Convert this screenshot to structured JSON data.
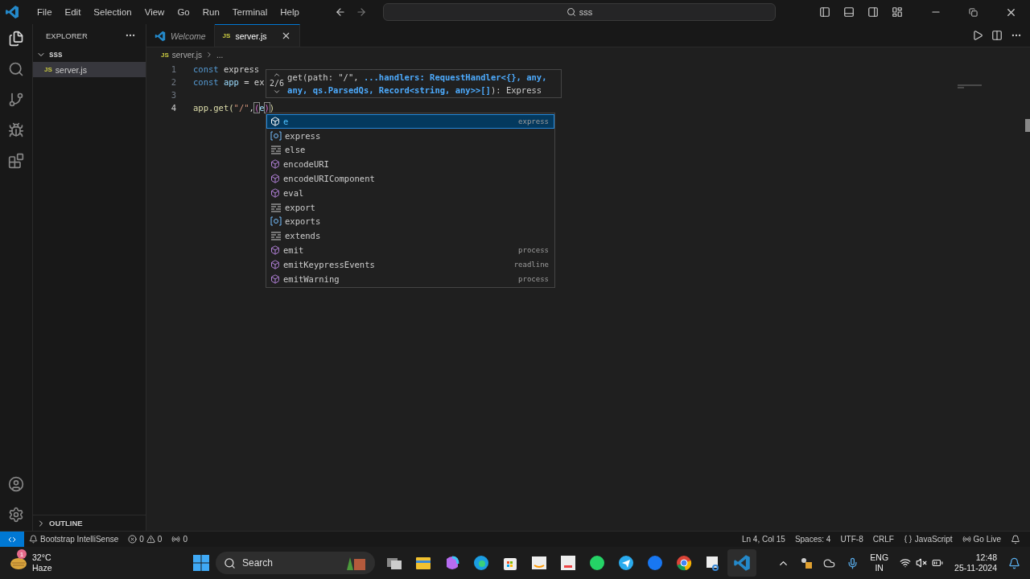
{
  "menu": [
    "File",
    "Edit",
    "Selection",
    "View",
    "Go",
    "Run",
    "Terminal",
    "Help"
  ],
  "command_center": {
    "value": "sss"
  },
  "sidebar": {
    "title": "EXPLORER",
    "folder": {
      "label": "sss",
      "expanded": true,
      "children": [
        {
          "label": "server.js",
          "badge": "JS",
          "selected": true
        }
      ]
    },
    "outline": {
      "label": "OUTLINE",
      "expanded": false
    }
  },
  "tabs": [
    {
      "label": "Welcome",
      "selected": false
    },
    {
      "label": "server.js",
      "badge": "JS",
      "selected": true
    }
  ],
  "breadcrumb": {
    "badge": "JS",
    "file": "server.js",
    "rest": "..."
  },
  "code_lines": [
    {
      "number": "1",
      "current": false,
      "tokens": [
        {
          "text": "const",
          "kind": "keyword"
        },
        {
          "text": " express",
          "kind": "plain"
        }
      ]
    },
    {
      "number": "2",
      "current": false,
      "tokens": [
        {
          "text": "const",
          "kind": "keyword"
        },
        {
          "text": " app",
          "kind": "variable"
        },
        {
          "text": " = ex",
          "kind": "plain"
        }
      ]
    },
    {
      "number": "3",
      "current": false
    },
    {
      "number": "4",
      "current": true,
      "tokens": [
        {
          "text": "app.get(",
          "kind": "function"
        },
        {
          "text": "\"/\"",
          "kind": "string"
        },
        {
          "text": ",",
          "kind": "plain"
        },
        {
          "text": "(",
          "kind": "bracket"
        },
        {
          "text": "e",
          "kind": "variable"
        },
        {
          "text": ")",
          "kind": "bracket"
        },
        {
          "text": ")",
          "kind": "function"
        }
      ]
    }
  ],
  "signature_help": {
    "counter": "2/6",
    "parts": [
      {
        "text": "get(path: \"/\", ",
        "active": false
      },
      {
        "text": "...handlers: RequestHandler<{}, any, any, qs.ParsedQs, Record<string, any>>[]",
        "active": true
      },
      {
        "text": "): Express",
        "active": false
      }
    ]
  },
  "suggestions": [
    {
      "label": "e",
      "detail": "express",
      "kind": "variable",
      "selected": true
    },
    {
      "label": "express",
      "kind": "module",
      "selected": false
    },
    {
      "label": "else",
      "kind": "keyword",
      "selected": false
    },
    {
      "label": "encodeURI",
      "kind": "variable",
      "selected": false
    },
    {
      "label": "encodeURIComponent",
      "kind": "variable",
      "selected": false
    },
    {
      "label": "eval",
      "kind": "variable",
      "selected": false
    },
    {
      "label": "export",
      "kind": "keyword",
      "selected": false
    },
    {
      "label": "exports",
      "kind": "module",
      "selected": false
    },
    {
      "label": "extends",
      "kind": "keyword",
      "selected": false
    },
    {
      "label": "emit",
      "detail": "process",
      "kind": "variable",
      "selected": false
    },
    {
      "label": "emitKeypressEvents",
      "detail": "readline",
      "kind": "variable",
      "selected": false
    },
    {
      "label": "emitWarning",
      "detail": "process",
      "kind": "variable",
      "selected": false
    }
  ],
  "status_bar": {
    "left": [
      {
        "kind": "extension",
        "text": "Bootstrap IntelliSense"
      },
      {
        "kind": "problems",
        "errors": "0",
        "warnings": "0"
      },
      {
        "kind": "ports",
        "text": "0"
      }
    ],
    "right": [
      "Ln 4, Col 15",
      "Spaces: 4",
      "UTF-8",
      "CRLF"
    ],
    "language": "JavaScript",
    "live": "Go Live"
  },
  "taskbar": {
    "weather": {
      "temp": "32°C",
      "condition": "Haze",
      "badge": "1"
    },
    "search": {
      "placeholder": "Search"
    },
    "lang": [
      "ENG",
      "IN"
    ],
    "time": "12:48",
    "date": "25-11-2024"
  }
}
